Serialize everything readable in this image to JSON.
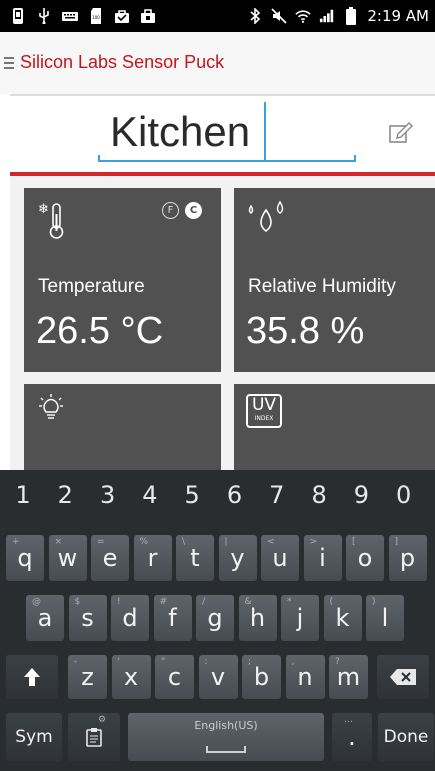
{
  "status_bar": {
    "time": "2:19 AM",
    "left_icons": [
      "phone-icon",
      "usb-icon",
      "keyboard-icon",
      "sd-card-icon",
      "briefcase-icon",
      "bag-icon"
    ],
    "right_icons": [
      "bluetooth-icon",
      "mute-icon",
      "wifi-icon",
      "signal-icon",
      "battery-icon"
    ]
  },
  "app_bar": {
    "title": "Silicon Labs Sensor Puck"
  },
  "device_name": {
    "value": "Kitchen"
  },
  "sensors": {
    "temperature": {
      "label": "Temperature",
      "value": "26.5 °C",
      "unit_f": "F",
      "unit_c": "C",
      "selected_unit": "C"
    },
    "humidity": {
      "label": "Relative Humidity",
      "value": "35.8 %"
    },
    "light": {
      "icon": "lightbulb-icon"
    },
    "uv": {
      "badge": "UV",
      "badge_sub": "INDEX"
    }
  },
  "keyboard": {
    "number_row": [
      "1",
      "2",
      "3",
      "4",
      "5",
      "6",
      "7",
      "8",
      "9",
      "0"
    ],
    "row1": [
      {
        "key": "q",
        "alt": "+"
      },
      {
        "key": "w",
        "alt": "×"
      },
      {
        "key": "e",
        "alt": "="
      },
      {
        "key": "r",
        "alt": "%"
      },
      {
        "key": "t",
        "alt": "\\"
      },
      {
        "key": "y",
        "alt": "|"
      },
      {
        "key": "u",
        "alt": "<"
      },
      {
        "key": "i",
        "alt": ">"
      },
      {
        "key": "o",
        "alt": "["
      },
      {
        "key": "p",
        "alt": "]"
      }
    ],
    "row2": [
      {
        "key": "a",
        "alt": "@"
      },
      {
        "key": "s",
        "alt": "$"
      },
      {
        "key": "d",
        "alt": "!"
      },
      {
        "key": "f",
        "alt": "#"
      },
      {
        "key": "g",
        "alt": "/"
      },
      {
        "key": "h",
        "alt": "&"
      },
      {
        "key": "j",
        "alt": "*"
      },
      {
        "key": "k",
        "alt": "("
      },
      {
        "key": "l",
        "alt": ")"
      }
    ],
    "row3": [
      {
        "key": "z",
        "alt": "-"
      },
      {
        "key": "x",
        "alt": "'"
      },
      {
        "key": "c",
        "alt": "\""
      },
      {
        "key": "v",
        "alt": ":"
      },
      {
        "key": "b",
        "alt": ";"
      },
      {
        "key": "n",
        "alt": ","
      },
      {
        "key": "m",
        "alt": "?"
      }
    ],
    "sym_label": "Sym",
    "space_label": "English(US)",
    "period": ".",
    "done_label": "Done"
  },
  "colors": {
    "accent_red": "#c4161c",
    "focus_blue": "#3ba0e0",
    "card_bg": "#515151",
    "keyboard_bg": "#2a2d30"
  }
}
